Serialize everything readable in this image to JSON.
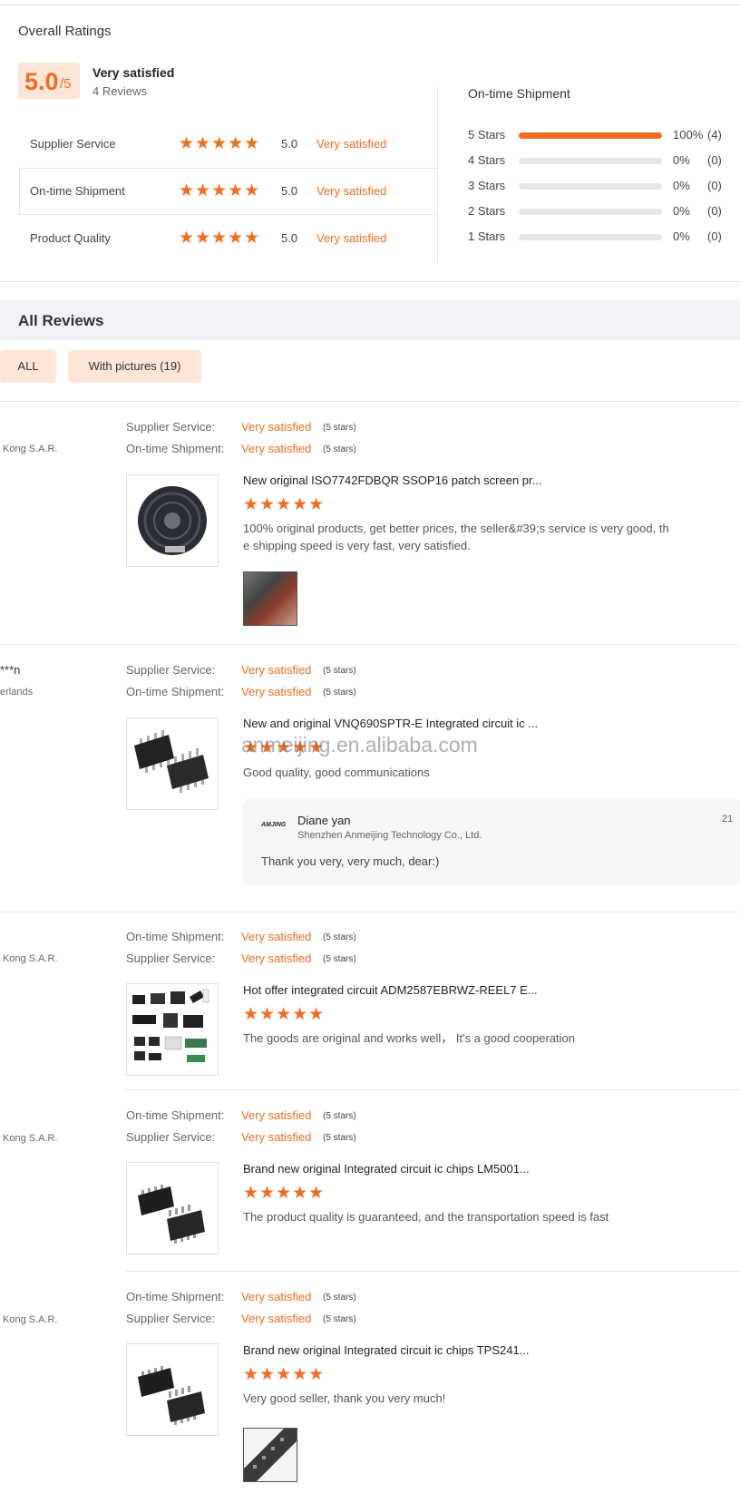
{
  "overall": {
    "heading": "Overall Ratings",
    "score": "5.0",
    "score_suffix": "/5",
    "verdict": "Very satisfied",
    "reviews_count": "4 Reviews"
  },
  "categories": [
    {
      "label": "Supplier Service",
      "score": "5.0",
      "verdict": "Very satisfied"
    },
    {
      "label": "On-time Shipment",
      "score": "5.0",
      "verdict": "Very satisfied"
    },
    {
      "label": "Product Quality",
      "score": "5.0",
      "verdict": "Very satisfied"
    }
  ],
  "distribution": {
    "heading": "On-time Shipment",
    "rows": [
      {
        "label": "5 Stars",
        "fraction": 1.0,
        "pct": "100%",
        "count": "(4)"
      },
      {
        "label": "4 Stars",
        "fraction": 0.0,
        "pct": "0%",
        "count": "(0)"
      },
      {
        "label": "3 Stars",
        "fraction": 0.0,
        "pct": "0%",
        "count": "(0)"
      },
      {
        "label": "2 Stars",
        "fraction": 0.0,
        "pct": "0%",
        "count": "(0)"
      },
      {
        "label": "1 Stars",
        "fraction": 0.0,
        "pct": "0%",
        "count": "(0)"
      }
    ]
  },
  "all_reviews": {
    "heading": "All Reviews",
    "filters": [
      "ALL",
      "With pictures (19)"
    ]
  },
  "star_glyphs": "★★★★★",
  "stars_note": "(5 stars)",
  "reviews": [
    {
      "region": "Kong S.A.R.",
      "meta": [
        {
          "label": "Supplier Service:",
          "value": "Very satisfied"
        },
        {
          "label": "On-time Shipment:",
          "value": "Very satisfied"
        }
      ],
      "product_title": "New original ISO7742FDBQR SSOP16 patch screen pr...",
      "text_lines": [
        "100% original products, get better prices, the seller&#39;s service is very good, th",
        "e shipping speed is very fast, very satisfied."
      ]
    },
    {
      "name": "***n",
      "region": "erlands",
      "meta": [
        {
          "label": "Supplier Service:",
          "value": "Very satisfied"
        },
        {
          "label": "On-time Shipment:",
          "value": "Very satisfied"
        }
      ],
      "product_title": "New and original VNQ690SPTR-E Integrated circuit ic ...",
      "watermark": "anmeijing.en.alibaba.com",
      "text_lines": [
        "Good quality, good communications"
      ],
      "reply": {
        "name": "Diane yan",
        "company": "Shenzhen Anmeijing Technology Co., Ltd.",
        "date": "21",
        "text": "Thank you very, very much, dear:)",
        "logo_text": "AMJING"
      }
    },
    {
      "region": "Kong S.A.R.",
      "meta": [
        {
          "label": "On-time Shipment:",
          "value": "Very satisfied"
        },
        {
          "label": "Supplier Service:",
          "value": "Very satisfied"
        }
      ],
      "product_title": "Hot offer integrated circuit ADM2587EBRWZ-REEL7 E...",
      "text_lines": [
        "The goods are original and works well， It's a good cooperation"
      ]
    },
    {
      "region": "Kong S.A.R.",
      "meta": [
        {
          "label": "On-time Shipment:",
          "value": "Very satisfied"
        },
        {
          "label": "Supplier Service:",
          "value": "Very satisfied"
        }
      ],
      "product_title": "Brand new original Integrated circuit ic chips LM5001...",
      "text_lines": [
        "The product quality is guaranteed, and the transportation speed is fast"
      ]
    },
    {
      "region": "Kong S.A.R.",
      "meta": [
        {
          "label": "On-time Shipment:",
          "value": "Very satisfied"
        },
        {
          "label": "Supplier Service:",
          "value": "Very satisfied"
        }
      ],
      "product_title": "Brand new original Integrated circuit ic chips TPS241...",
      "text_lines": [
        "Very good seller, thank you very much!"
      ]
    }
  ],
  "colors": {
    "accent": "#f26d21",
    "score_bg": "#fde6d8",
    "section_bg": "#f2f3f7"
  }
}
